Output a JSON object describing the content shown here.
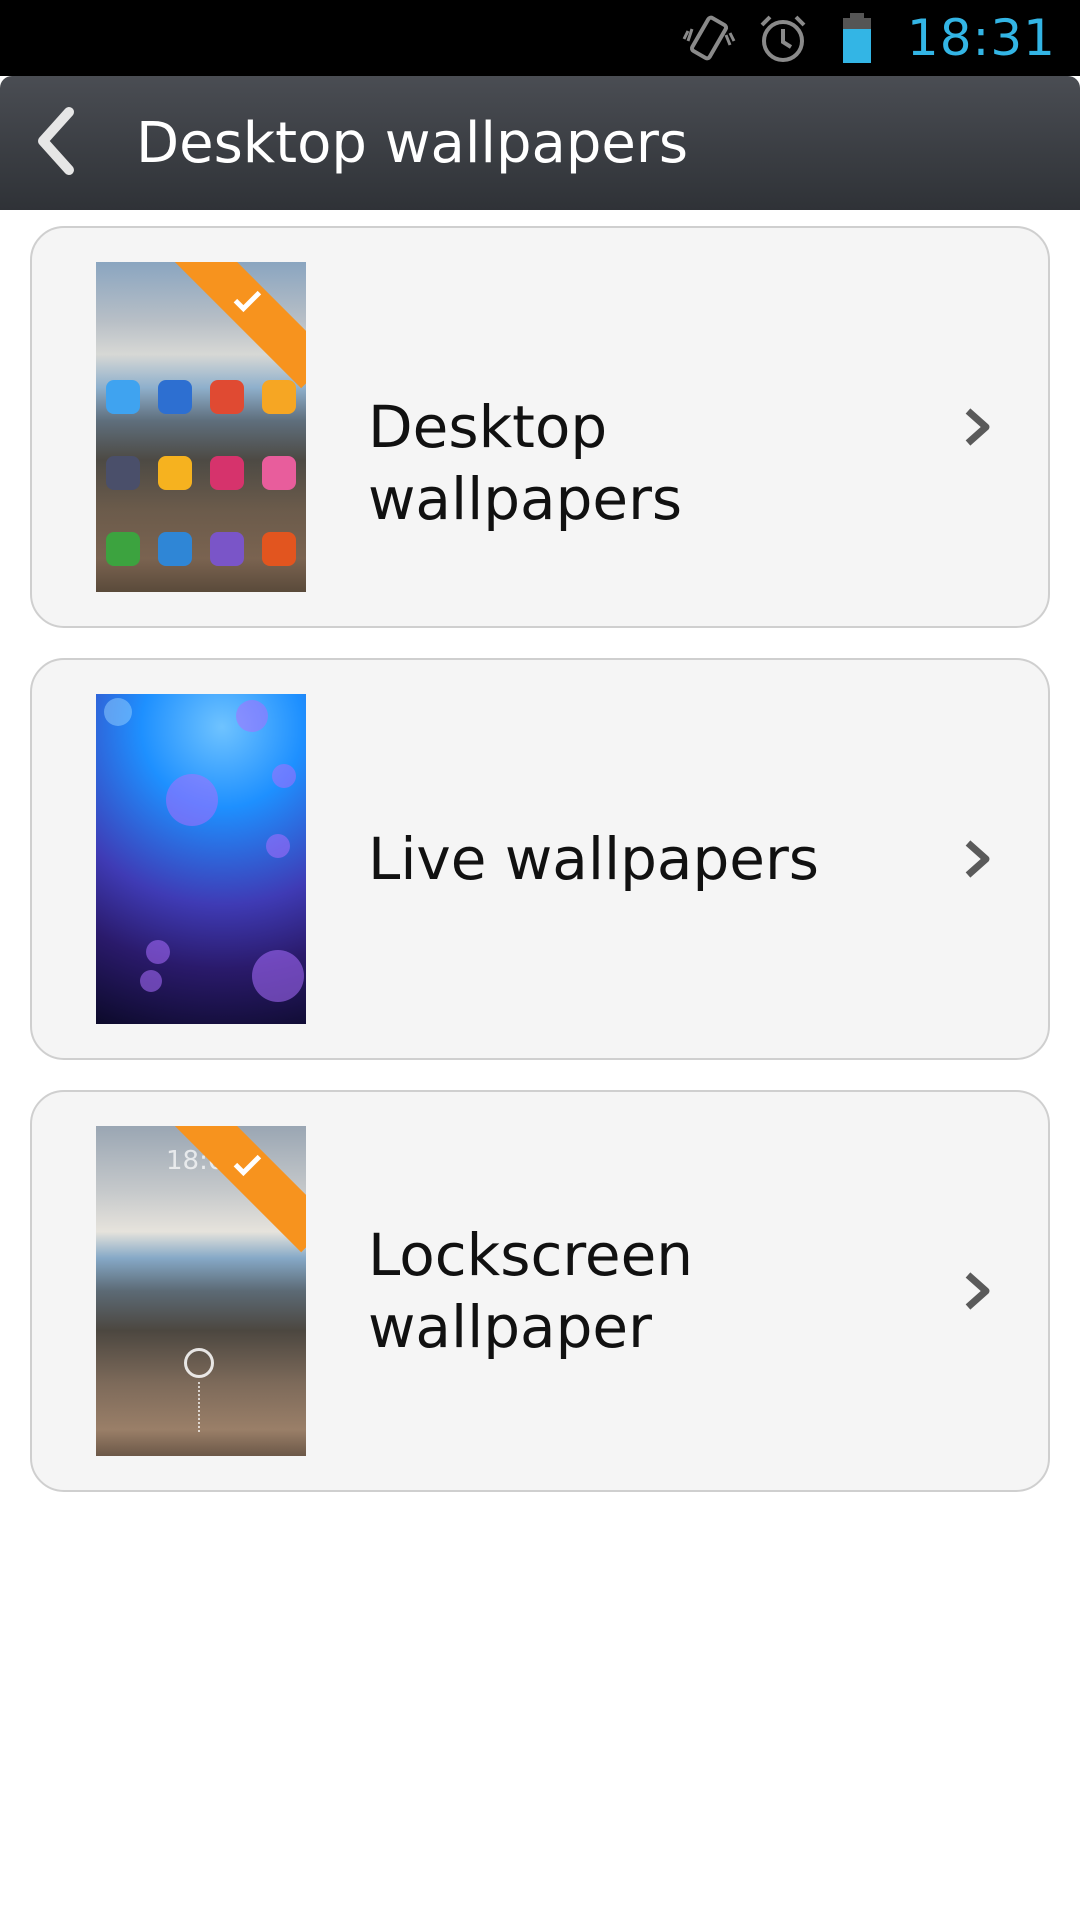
{
  "status_bar": {
    "time": "18:31",
    "icons": [
      "vibrate-icon",
      "alarm-icon",
      "battery-icon"
    ],
    "clock_color": "#33b5e5"
  },
  "header": {
    "title": "Desktop wallpapers",
    "back_icon": "chevron-left-icon"
  },
  "cards": [
    {
      "label": "Desktop wallpapers",
      "thumbnail": "desktop-wallpaper-preview",
      "selected": true
    },
    {
      "label": "Live wallpapers",
      "thumbnail": "live-wallpaper-preview",
      "selected": false
    },
    {
      "label": "Lockscreen wallpaper",
      "thumbnail": "lockscreen-wallpaper-preview",
      "selected": true
    }
  ],
  "lock_preview_time": "18:0",
  "colors": {
    "accent": "#f7931e",
    "title_bar": "#3a3d42",
    "card_bg": "#f5f5f5"
  }
}
